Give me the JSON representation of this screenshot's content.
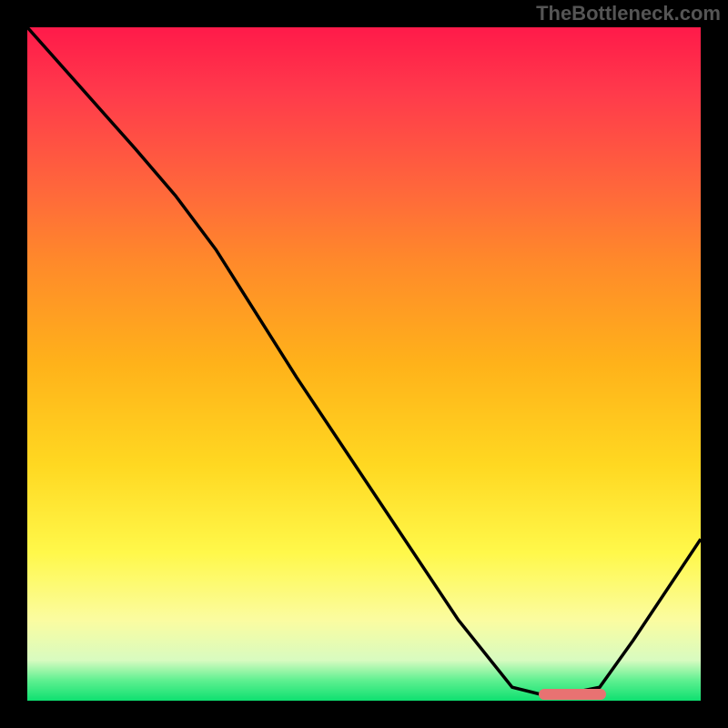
{
  "watermark": "TheBottleneck.com",
  "chart_data": {
    "type": "line",
    "title": "",
    "xlabel": "",
    "ylabel": "",
    "xlim": [
      0,
      100
    ],
    "ylim": [
      0,
      100
    ],
    "series": [
      {
        "name": "curve",
        "x": [
          0,
          8,
          16,
          22,
          28,
          40,
          52,
          64,
          72,
          76,
          80,
          85,
          90,
          100
        ],
        "y": [
          100,
          91,
          82,
          75,
          67,
          48,
          30,
          12,
          2,
          1,
          1,
          2,
          9,
          24
        ]
      }
    ],
    "optimal_marker": {
      "x_start": 76,
      "x_end": 86,
      "y": 1
    },
    "colors": {
      "gradient_top": "#ff1a4a",
      "gradient_mid": "#ffd821",
      "gradient_bottom": "#0ee070",
      "curve": "#000000",
      "marker": "#e87272"
    }
  }
}
